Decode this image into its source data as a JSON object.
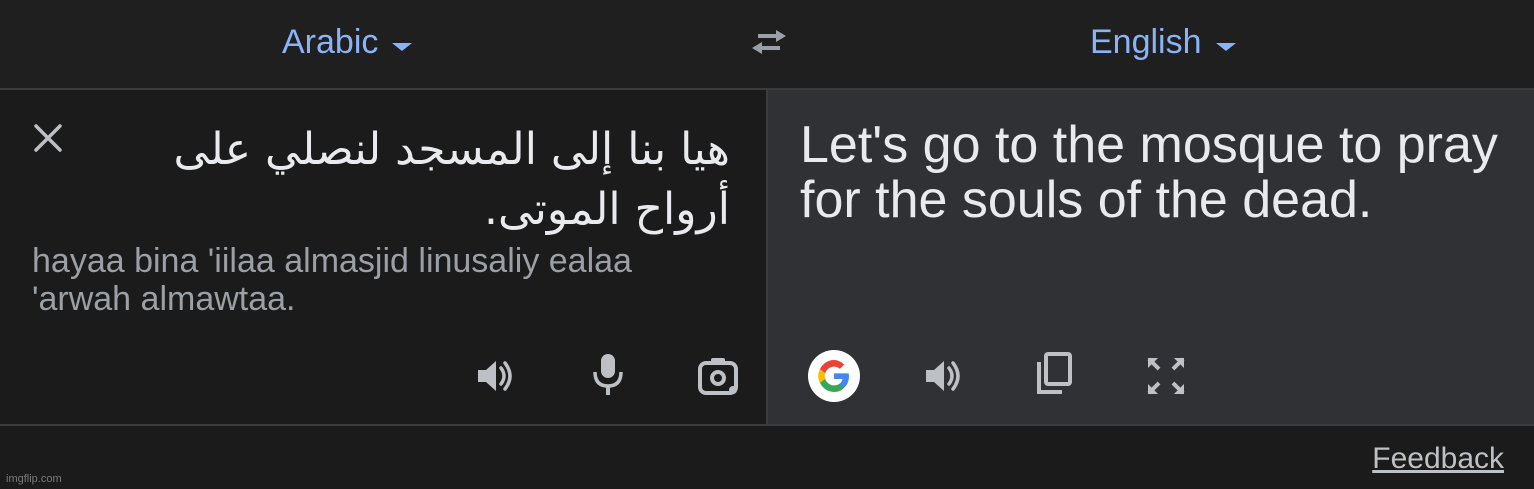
{
  "header": {
    "source_language": "Arabic",
    "target_language": "English",
    "swap_icon": "swap-arrows-icon"
  },
  "source": {
    "text": "هيا بنا إلى المسجد لنصلي على أرواح الموتى.",
    "transliteration": "hayaa bina 'iilaa almasjid linusaliy ealaa 'arwah almawtaa.",
    "icons": [
      "close-icon",
      "volume-icon",
      "microphone-icon",
      "camera-icon"
    ]
  },
  "target": {
    "text": "Let's go to the mosque to pray for the souls of the dead.",
    "icons": [
      "google-logo-icon",
      "volume-icon",
      "copy-icon",
      "fullscreen-icon"
    ]
  },
  "footer": {
    "feedback_label": "Feedback",
    "watermark": "imgflip.com"
  },
  "colors": {
    "accent": "#8ab4f8",
    "background": "#202124",
    "panel_right": "#303134",
    "text_primary": "#e8eaed",
    "text_secondary": "#9aa0a6"
  }
}
